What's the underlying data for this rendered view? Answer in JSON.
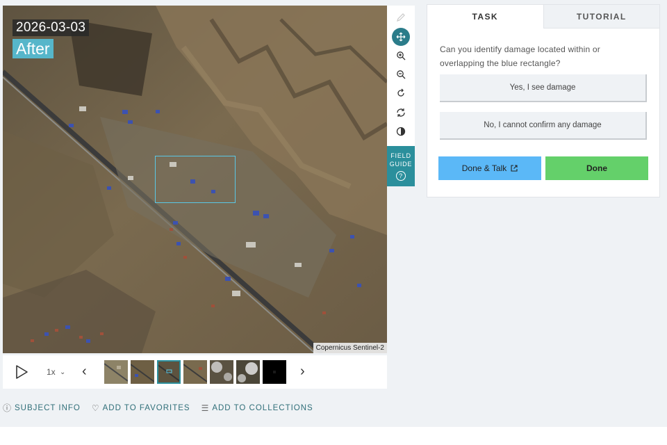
{
  "viewer": {
    "date": "2026-03-03",
    "label": "After",
    "credit": "Copernicus Sentinel-2"
  },
  "toolbar": {
    "tools": [
      "pencil-icon",
      "move-icon",
      "zoom-in-icon",
      "zoom-out-icon",
      "rotate-icon",
      "reset-icon",
      "invert-icon"
    ],
    "active_tool": "move-icon",
    "field_guide_line1": "FIELD",
    "field_guide_line2": "GUIDE",
    "field_guide_help": "?"
  },
  "player": {
    "speed": "1x",
    "prev": "‹",
    "next": "›",
    "frame_count": 7,
    "active_frame": 3
  },
  "footer": {
    "subject_info": "SUBJECT INFO",
    "add_favorites": "ADD TO FAVORITES",
    "add_collections": "ADD TO COLLECTIONS"
  },
  "task": {
    "tab_task": "TASK",
    "tab_tutorial": "TUTORIAL",
    "question": "Can you identify damage located within or overlapping the blue rectangle?",
    "answer_yes": "Yes, I see damage",
    "answer_no": "No, I cannot confirm any damage",
    "done_talk": "Done & Talk",
    "done": "Done"
  },
  "colors": {
    "accent": "#2b8f9c",
    "after_label": "#56b6ca",
    "rectangle": "#5ac8e6",
    "done_talk": "#5bb8f7",
    "done": "#64d06a"
  }
}
